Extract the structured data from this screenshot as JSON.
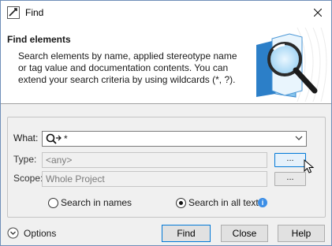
{
  "window": {
    "title": "Find"
  },
  "header": {
    "title": "Find elements",
    "description": "Search elements by name, applied stereotype name or tag value and documentation contents. You can extend your search criteria by using wildcards (*, ?)."
  },
  "form": {
    "what": {
      "label": "What:",
      "value": "*"
    },
    "type": {
      "label": "Type:",
      "value": "<any>",
      "button": "..."
    },
    "scope": {
      "label": "Scope:",
      "value": "Whole Project",
      "button": "..."
    },
    "search_mode": {
      "options": [
        {
          "label": "Search in names",
          "selected": false
        },
        {
          "label": "Search in all texts",
          "selected": true
        }
      ]
    }
  },
  "footer": {
    "options_label": "Options",
    "find_label": "Find",
    "close_label": "Close",
    "help_label": "Help"
  },
  "colors": {
    "accent": "#0078d7",
    "info": "#3c8ee6",
    "border": "#adadad"
  }
}
